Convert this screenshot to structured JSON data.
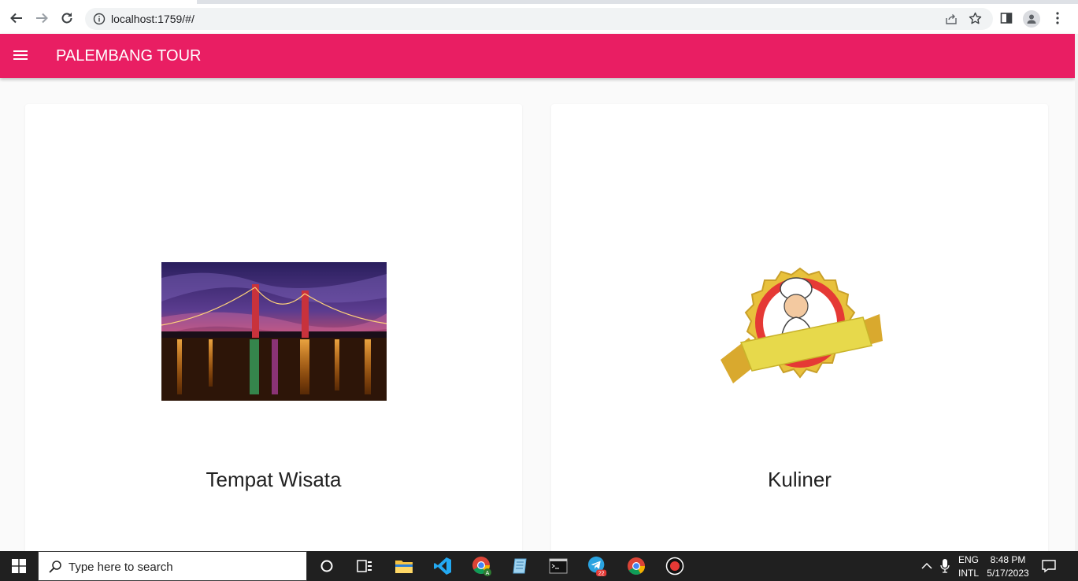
{
  "browser": {
    "url": "localhost:1759/#/"
  },
  "appbar": {
    "title": "PALEMBANG TOUR"
  },
  "cards": [
    {
      "label": "Tempat Wisata",
      "image": "ampera-bridge-night-photo"
    },
    {
      "label": "Kuliner",
      "image": "chef-badge-illustration"
    }
  ],
  "taskbar": {
    "search_placeholder": "Type here to search",
    "telegram_badge": "22",
    "lang_top": "ENG",
    "lang_bottom": "INTL",
    "time": "8:48 PM",
    "date": "5/17/2023"
  },
  "colors": {
    "appbar": "#e91e63",
    "background": "#fafafa",
    "taskbar": "#202020"
  }
}
